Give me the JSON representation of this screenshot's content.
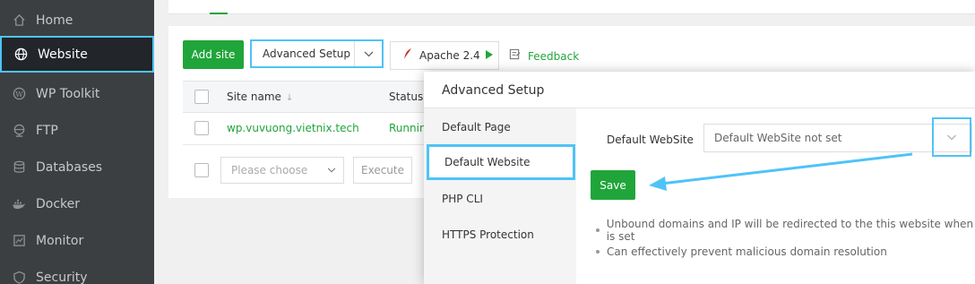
{
  "sidebar": {
    "items": [
      {
        "label": "Home",
        "icon": "home-icon"
      },
      {
        "label": "Website",
        "icon": "globe-icon"
      },
      {
        "label": "WP Toolkit",
        "icon": "wordpress-icon"
      },
      {
        "label": "FTP",
        "icon": "ftp-globe-icon"
      },
      {
        "label": "Databases",
        "icon": "database-icon"
      },
      {
        "label": "Docker",
        "icon": "docker-icon"
      },
      {
        "label": "Monitor",
        "icon": "monitor-icon"
      },
      {
        "label": "Security",
        "icon": "shield-icon"
      }
    ]
  },
  "toolbar": {
    "add_site": "Add site",
    "advanced_setup": "Advanced Setup",
    "apache": "Apache 2.4",
    "feedback": "Feedback"
  },
  "table": {
    "headers": {
      "name": "Site name",
      "status": "Status"
    },
    "rows": [
      {
        "name": "wp.vuvuong.vietnix.tech",
        "status": "Running"
      }
    ]
  },
  "batch": {
    "placeholder": "Please choose",
    "execute": "Execute"
  },
  "modal": {
    "title": "Advanced Setup",
    "tabs": [
      "Default Page",
      "Default Website",
      "PHP CLI",
      "HTTPS Protection"
    ],
    "field_label": "Default WebSite",
    "select_value": "Default WebSite not set",
    "save": "Save",
    "tips": [
      "Unbound domains and IP will be redirected to the this website when is set",
      "Can effectively prevent malicious domain resolution"
    ]
  },
  "colors": {
    "accent": "#20a53a",
    "highlight": "#4fc3f7",
    "sidebar_bg": "#3b3f42"
  }
}
